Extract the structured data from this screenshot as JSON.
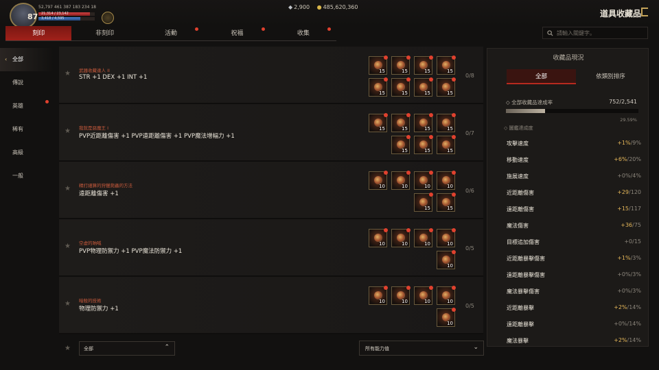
{
  "player": {
    "level": "87",
    "stats_line": "52,797  461  387  183  234  18",
    "hp_text": "21,314 / 23,142",
    "mp_text": "3,418 / 4,595"
  },
  "currency": {
    "silver": "2,900",
    "gold": "485,620,360"
  },
  "page_title": "道具收藏品",
  "tabs": [
    {
      "label": "刻印",
      "active": true,
      "dot": false
    },
    {
      "label": "非刻印",
      "active": false,
      "dot": false
    },
    {
      "label": "活動",
      "active": false,
      "dot": true
    },
    {
      "label": "祝福",
      "active": false,
      "dot": true
    },
    {
      "label": "收集",
      "active": false,
      "dot": true
    }
  ],
  "search": {
    "placeholder": "請輸入關鍵字。"
  },
  "sidebar": [
    {
      "label": "全部",
      "active": true,
      "dot": false
    },
    {
      "label": "傳說",
      "active": false,
      "dot": false
    },
    {
      "label": "英雄",
      "active": false,
      "dot": true
    },
    {
      "label": "稀有",
      "active": false,
      "dot": false
    },
    {
      "label": "高級",
      "active": false,
      "dot": false
    },
    {
      "label": "一般",
      "active": false,
      "dot": false
    }
  ],
  "collections": [
    {
      "title": "武器收藏達人 II",
      "effect": "STR +1 DEX +1 INT +1",
      "count": "0/8",
      "slots": [
        "15",
        "15",
        "15",
        "15",
        "15",
        "15",
        "15",
        "15"
      ]
    },
    {
      "title": "我就是惡魔王 I",
      "effect": "PVP近距離傷害 +1 PVP遠距離傷害 +1 PVP魔法增幅力 +1",
      "count": "0/7",
      "slots": [
        "15",
        "15",
        "15",
        "15",
        "15",
        "15",
        "15"
      ]
    },
    {
      "title": "精打細算的狩獵爬蟲的方法",
      "effect": "遠距離傷害 +1",
      "count": "0/6",
      "slots": [
        "10",
        "10",
        "10",
        "10",
        "15",
        "15"
      ]
    },
    {
      "title": "空虛的吶喊",
      "effect": "PVP物理防禦力 +1 PVP魔法防禦力 +1",
      "count": "0/5",
      "slots": [
        "10",
        "10",
        "10",
        "10",
        "10"
      ]
    },
    {
      "title": "暗殺的技術",
      "effect": "物理防禦力 +1",
      "count": "0/5",
      "slots": [
        "10",
        "10",
        "10",
        "10",
        "10"
      ]
    }
  ],
  "bottom": {
    "filter": "全部",
    "ability": "所有能力值"
  },
  "panel": {
    "title": "收藏品現況",
    "tabs": [
      "全部",
      "依類別排序"
    ],
    "overall_label": "◇ 全部收藏品達成率",
    "overall_value": "752/2,541",
    "overall_fraction": 0.2959,
    "overall_pct": "29.59%",
    "section": "◇ 圖鑑達成度",
    "stats": [
      {
        "name": "攻擊速度",
        "gain": "+1%",
        "max": "/9%",
        "zero": false
      },
      {
        "name": "移動速度",
        "gain": "+6%",
        "max": "/20%",
        "zero": false
      },
      {
        "name": "施展速度",
        "gain": "+0%",
        "max": "/4%",
        "zero": true
      },
      {
        "name": "近距離傷害",
        "gain": "+29",
        "max": "/120",
        "zero": false
      },
      {
        "name": "遠距離傷害",
        "gain": "+15",
        "max": "/117",
        "zero": false
      },
      {
        "name": "魔法傷害",
        "gain": "+36",
        "max": "/75",
        "zero": false
      },
      {
        "name": "目標追加傷害",
        "gain": "+0",
        "max": "/15",
        "zero": true
      },
      {
        "name": "近距離暴擊傷害",
        "gain": "+1%",
        "max": "/3%",
        "zero": false
      },
      {
        "name": "遠距離暴擊傷害",
        "gain": "+0%",
        "max": "/3%",
        "zero": true
      },
      {
        "name": "魔法暴擊傷害",
        "gain": "+0%",
        "max": "/3%",
        "zero": true
      },
      {
        "name": "近距離暴擊",
        "gain": "+2%",
        "max": "/14%",
        "zero": false
      },
      {
        "name": "遠距離暴擊",
        "gain": "+0%",
        "max": "/14%",
        "zero": true
      },
      {
        "name": "魔法暴擊",
        "gain": "+2%",
        "max": "/14%",
        "zero": false
      }
    ]
  }
}
